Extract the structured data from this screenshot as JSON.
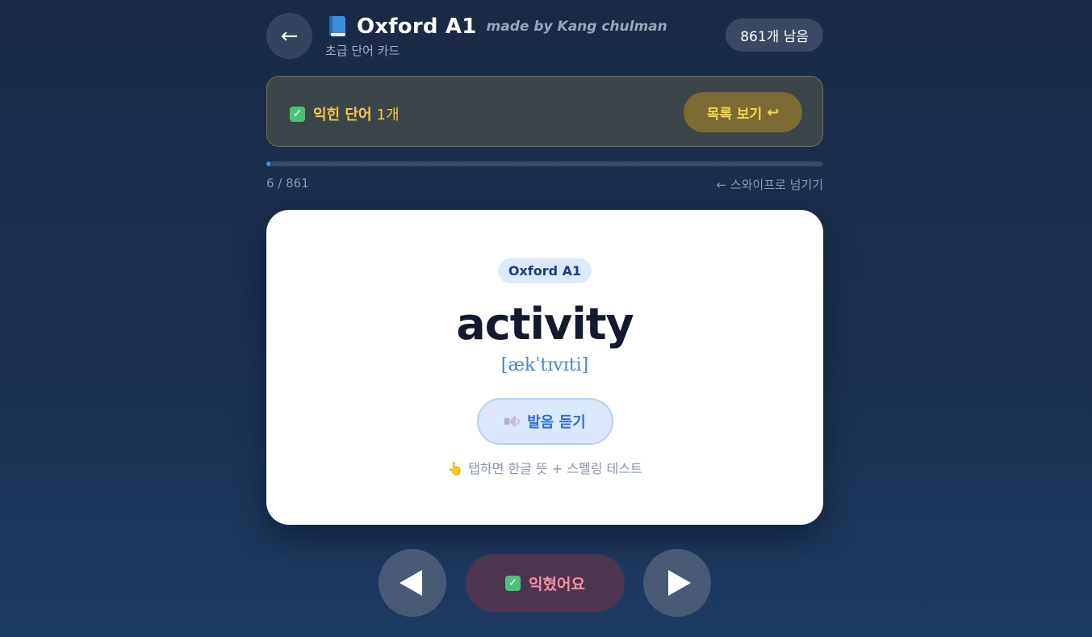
{
  "header": {
    "back_label": "←",
    "title": "Oxford A1",
    "made_by": "made by Kang chulman",
    "subtitle": "초급 단어 카드",
    "remaining": "861개 남음",
    "book_icon": "blue-book-icon"
  },
  "learned_banner": {
    "icon": "check-box-icon",
    "label": "익힌 단어",
    "count": "1개",
    "list_button": "목록 보기",
    "list_button_icon": "↩"
  },
  "progress": {
    "current": 6,
    "total": 861,
    "text": "6 / 861",
    "swipe_hint": "← 스와이프로 넘기기"
  },
  "card": {
    "level_badge": "Oxford A1",
    "word": "activity",
    "phonetic": "[ækˈtɪvɪti]",
    "listen_button": "발음 듣기",
    "tap_hint_icon": "👆",
    "tap_hint": "탭하면 한글 뜻 + 스펠링 테스트"
  },
  "controls": {
    "prev_icon": "triangle-left-icon",
    "next_icon": "triangle-right-icon",
    "learned_button": "익혔어요"
  },
  "colors": {
    "accent": "#4a90e2",
    "gold": "#f4c94a",
    "pink": "#f78fa0",
    "check_green": "#48c47a"
  }
}
